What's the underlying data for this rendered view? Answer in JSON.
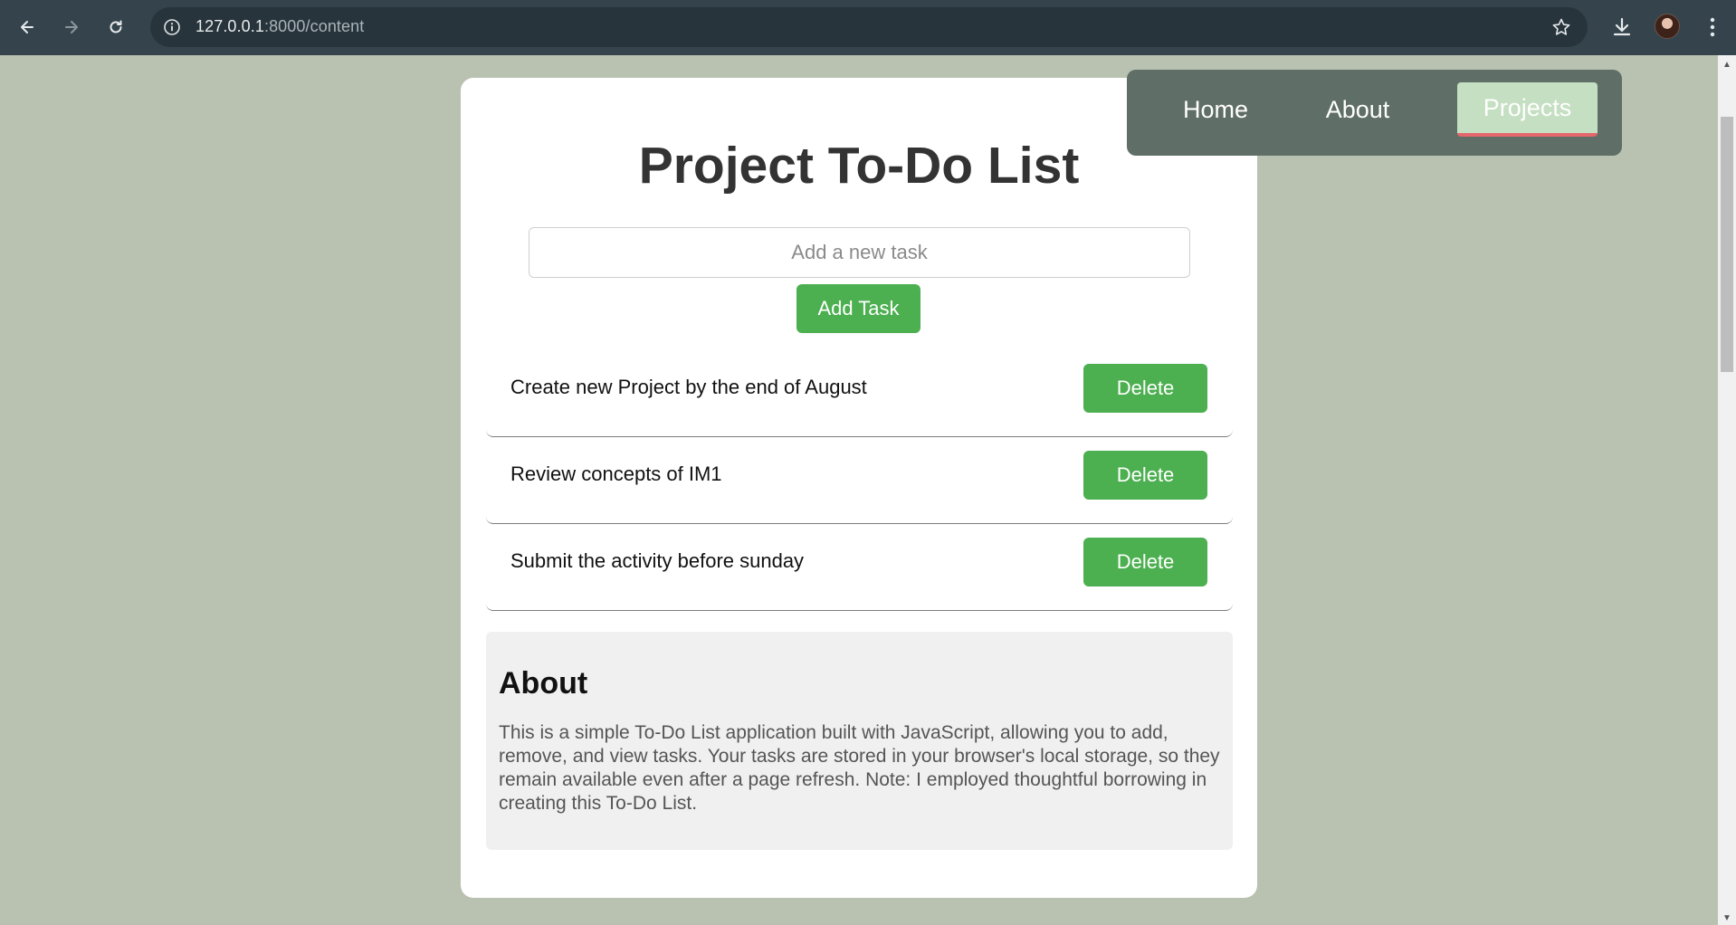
{
  "browser": {
    "url_host": "127.0.0.1",
    "url_path": ":8000/content"
  },
  "page": {
    "title": "Project To-Do List",
    "task_input_placeholder": "Add a new task",
    "add_button_label": "Add Task",
    "tasks": [
      {
        "text": "Create new Project by the end of August",
        "delete_label": "Delete"
      },
      {
        "text": "Review concepts of IM1",
        "delete_label": "Delete"
      },
      {
        "text": "Submit the activity before sunday",
        "delete_label": "Delete"
      }
    ],
    "about": {
      "heading": "About",
      "body": "This is a simple To-Do List application built with JavaScript, allowing you to add, remove, and view tasks. Your tasks are stored in your browser's local storage, so they remain available even after a page refresh. Note: I employed thoughtful borrowing in creating this To-Do List."
    }
  },
  "nav": {
    "items": [
      {
        "label": "Home",
        "active": false
      },
      {
        "label": "About",
        "active": false
      },
      {
        "label": "Projects",
        "active": true
      }
    ]
  },
  "colors": {
    "page_bg": "#b9c2b1",
    "accent_green": "#4caf50",
    "nav_bg": "#5f6e66",
    "nav_active_bg": "#c5dfc2",
    "nav_active_underline": "#e5666b"
  }
}
